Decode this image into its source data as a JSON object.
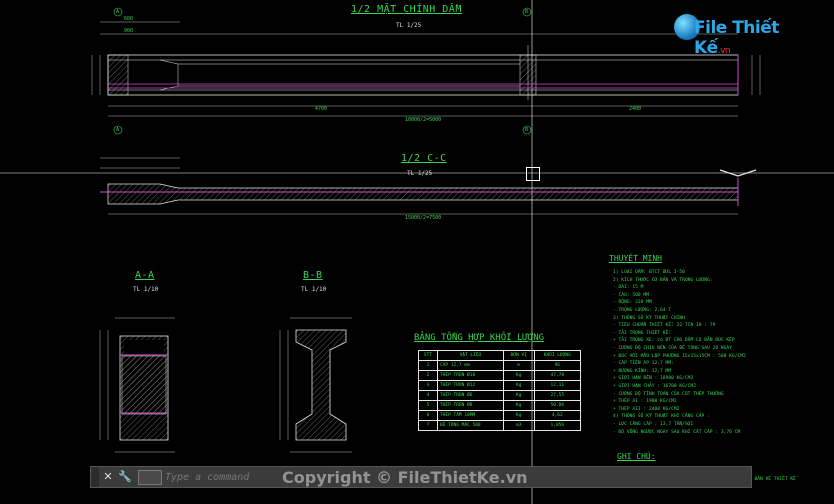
{
  "logo": {
    "text": "File Thiết Kế",
    "suffix": ".vn"
  },
  "drawing": {
    "title_plan": "1/2 MẶT CHÍNH DẦM",
    "scale_plan": "TL 1/25",
    "title_section": "1/2 C-C",
    "scale_section": "TL 1/25",
    "title_aa": "A-A",
    "scale_aa": "TL 1/10",
    "title_bb": "B-B",
    "scale_bb": "TL 1/10",
    "dim_plan_bottom": [
      "4700",
      "2400",
      "10000/2=5000"
    ],
    "dim_section_bottom": "15000/2=7500",
    "dim_top": [
      "600",
      "900"
    ],
    "label_a": "A",
    "label_b": "B",
    "label_c": "C"
  },
  "table": {
    "title": "BẢNG TỔNG HỢP KHỐI LƯỢNG",
    "headers": [
      "STT",
      "VẬT LIỆU",
      "ĐƠN VỊ",
      "KHỐI LƯỢNG"
    ],
    "rows": [
      [
        "1",
        "CÁP 12,7 mm",
        "m",
        "96"
      ],
      [
        "2",
        "THÉP TRÒN Ø10",
        "Kg",
        "47,78"
      ],
      [
        "3",
        "THÉP TRÒN Ø12",
        "Kg",
        "12,11"
      ],
      [
        "4",
        "THÉP TRÒN Ø6",
        "Kg",
        "27,55"
      ],
      [
        "5",
        "THÉP TRÒN Ø8",
        "Kg",
        "50,86"
      ],
      [
        "6",
        "THÉP TẤM 10MM",
        "Kg",
        "4,62"
      ],
      [
        "7",
        "BÊ TÔNG MÁC 500",
        "m3",
        "1,056"
      ]
    ]
  },
  "notes": {
    "title": "THUYẾT MINH",
    "lines": [
      "1) LOẠI DẦM: BTCT DƯL I-50",
      "2) KÍCH THƯỚC CƠ BẢN VÀ TRỌNG LƯỢNG:",
      "  - DÀI: 15 M",
      "  - CAO: 500 MM",
      "  - RỘNG: 220 MM",
      "  - TRỌNG LƯỢNG: 2,64 T",
      "3) THÔNG SỐ KỸ THUẬT CHÍNH",
      "  - TIÊU CHUẨN THIẾT KẾ: 22 TCN 18 : 79",
      "  - TẢI TRỌNG THIẾT KẾ:",
      "  + TẢI TRỌNG XE: có BT CHO DẦM CÓ BẢN ĐÚC KẾP",
      "  - CƯỜNG ĐỘ CHỊU NÉN CỦA BÊ TÔNG SAU 28 NGÀY",
      "  + ĐÚC VỚI MẪU LẬP PHƯƠNG 15x15x15CM : 500 KG/CM2",
      "  - CÁP TIỀN ÁP 12,7 MM:",
      "  + ĐƯỜNG KÍNH: 12,7 MM",
      "  + GIỚI HẠN BỀN : 18900 KG/CM2",
      "  + GIỚI HẠN CHẢY : 16700 KG/CM2",
      "  - CƯỜNG ĐỘ TÍNH TOÁN CỦA CỐT THÉP THƯỜNG",
      "  + THÉP AI : 1900 KG/CM2",
      "  + THÉP AII : 2400 KG/CM2",
      "4) THÔNG SỐ KỸ THUẬT KHI CĂNG CÁP :",
      "  - LỰC CĂNG CÁP : 13,7 TẤN/SỢI",
      "  - ĐỘ VÕNG NGƯỢC NGAY SAU KHI CẮT CÁP : 3,76 CM"
    ],
    "ghichu_title": "GHI CHÚ:",
    "ghichu_lines": [
      "+ KÍCH THƯỚC DÙNG TRONG BẢN VẼ: MM",
      "+ CÁC ĐIỂM VẼ VÀ CÁC CHI TIẾT PHẢI THEO ĐÚNG BẢN VẼ THIẾT KẾ"
    ]
  },
  "command": {
    "placeholder": "Type a command",
    "close_label": "✕",
    "customize_label": "🔧",
    "history_label": "▢▾"
  },
  "copyright": "Copyright © FileThietKe.vn",
  "colors": {
    "line": "#e6e6e6",
    "text": "#39d353",
    "dim": "#39d353",
    "magenta": "#d24bd2",
    "hatch": "#9a9a9a"
  }
}
